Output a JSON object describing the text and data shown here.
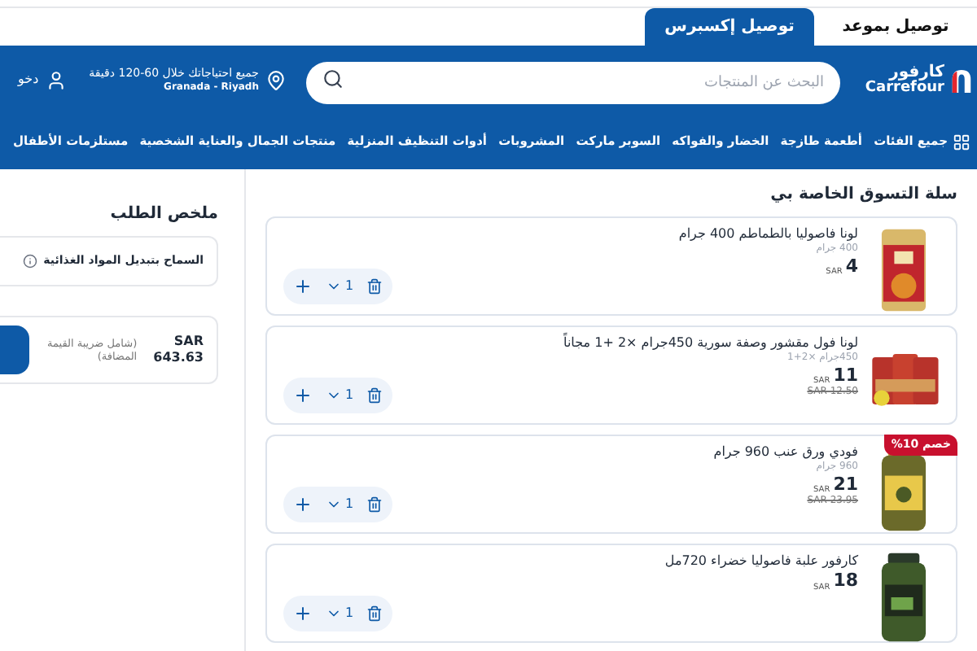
{
  "delivery_tabs": [
    {
      "label": "توصيل بموعد",
      "selected": false
    },
    {
      "label": "توصيل إكسبرس",
      "selected": true
    }
  ],
  "header": {
    "logo_arabic": "كارفور",
    "logo_latin": "Carrefour",
    "search": {
      "placeholder": "البحث عن المنتجات"
    },
    "location": {
      "line1": "جميع احتياجاتك خلال 60-120 دقيقة",
      "line2": "Granada - Riyadh"
    },
    "account": "دخو"
  },
  "nav": [
    "جميع الفئات",
    "أطعمة طازجة",
    "الخضار والفواكه",
    "السوبر ماركت",
    "المشروبات",
    "أدوات التنظيف المنزلية",
    "منتجات الجمال والعناية الشخصية",
    "مستلزمات الأطفال"
  ],
  "cart": {
    "title": "سلة التسوق الخاصة بي",
    "items": [
      {
        "name": "لونا فاصوليا بالطماطم 400 جرام",
        "size": "400 جرام",
        "price": "4",
        "currency": "SAR",
        "quantity": "1"
      },
      {
        "name": "لونا فول مقشور وصفة سورية 450جرام ×2 +1 مجاناً",
        "size": "450جرام ×2+1",
        "price": "11",
        "currency": "SAR",
        "old_price": "SAR 12.50",
        "quantity": "1"
      },
      {
        "name": "فودي ورق عنب 960 جرام",
        "size": "960 جرام",
        "price": "21",
        "currency": "SAR",
        "old_price": "SAR 23.95",
        "badge": "خصم 10%",
        "quantity": "1"
      },
      {
        "name": "كارفور علبة فاصوليا خضراء 720مل",
        "price": "18",
        "currency": "SAR",
        "quantity": "1"
      }
    ]
  },
  "summary": {
    "title": "ملخص الطلب",
    "substitution_label": "السماح بتبديل المواد الغذائية",
    "total_currency": "SAR",
    "total": "643.63",
    "vat_note": "(شامل ضريبة القيمة المضافة)"
  }
}
